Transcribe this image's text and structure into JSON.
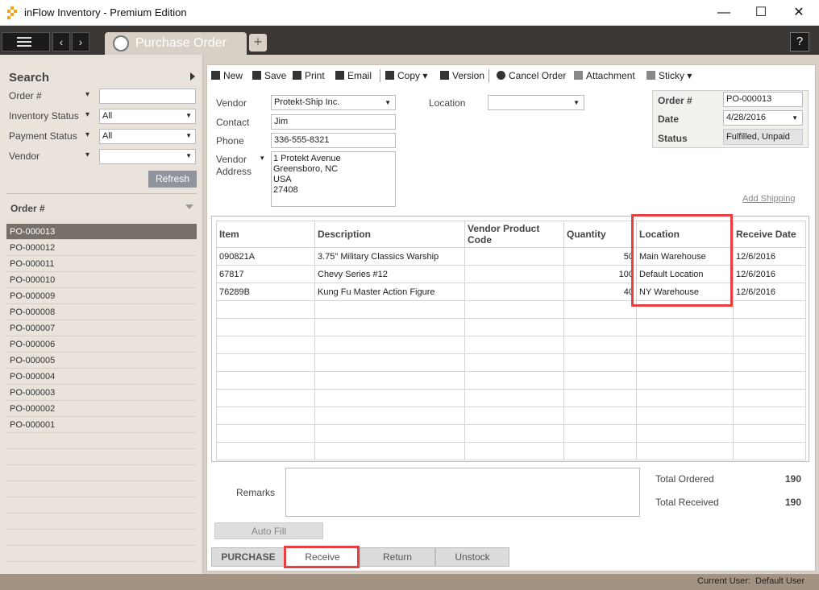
{
  "window": {
    "title": "inFlow Inventory - Premium Edition",
    "minimize": "—",
    "maximize": "☐",
    "close": "✕"
  },
  "topnav": {
    "menu_icon": "hamburger-icon",
    "back": "‹",
    "forward": "›",
    "tab_label": "Purchase Order",
    "add_tab": "+",
    "help": "?"
  },
  "sidebar": {
    "search_title": "Search",
    "filters": [
      {
        "label": "Order #",
        "value": ""
      },
      {
        "label": "Inventory Status",
        "value": "All"
      },
      {
        "label": "Payment Status",
        "value": "All"
      },
      {
        "label": "Vendor",
        "value": ""
      }
    ],
    "refresh": "Refresh",
    "order_header": "Order #",
    "orders": [
      "PO-000013",
      "PO-000012",
      "PO-000011",
      "PO-000010",
      "PO-000009",
      "PO-000008",
      "PO-000007",
      "PO-000006",
      "PO-000005",
      "PO-000004",
      "PO-000003",
      "PO-000002",
      "PO-000001"
    ]
  },
  "toolbar": {
    "new": "New",
    "save": "Save",
    "print": "Print",
    "email": "Email",
    "copy": "Copy",
    "version": "Version",
    "cancel": "Cancel Order",
    "attachment": "Attachment",
    "sticky": "Sticky"
  },
  "form": {
    "vendor_label": "Vendor",
    "vendor": "Protekt-Ship Inc.",
    "contact_label": "Contact",
    "contact": "Jim",
    "phone_label": "Phone",
    "phone": "336-555-8321",
    "address_label_1": "Vendor",
    "address_label_2": "Address",
    "address": [
      "1 Protekt Avenue",
      "Greensboro, NC",
      "USA",
      "27408"
    ],
    "location_label": "Location",
    "location": "",
    "order_label": "Order #",
    "order": "PO-000013",
    "date_label": "Date",
    "date": "4/28/2016",
    "status_label": "Status",
    "status": "Fulfilled, Unpaid",
    "add_shipping": "Add Shipping"
  },
  "grid": {
    "headers": [
      "Item",
      "Description",
      "Vendor Product Code",
      "Quantity",
      "Location",
      "Receive Date"
    ],
    "rows": [
      [
        "090821A",
        "3.75\" Military Classics Warship",
        "",
        "50",
        "Main Warehouse",
        "12/6/2016"
      ],
      [
        "67817",
        "Chevy Series #12",
        "",
        "100",
        "Default Location",
        "12/6/2016"
      ],
      [
        "76289B",
        "Kung Fu Master Action Figure",
        "",
        "40",
        "NY Warehouse",
        "12/6/2016"
      ]
    ]
  },
  "bottom": {
    "remarks_label": "Remarks",
    "total_ordered_label": "Total Ordered",
    "total_ordered": "190",
    "total_received_label": "Total Received",
    "total_received": "190",
    "auto_fill": "Auto Fill",
    "tabs": [
      "PURCHASE",
      "Receive",
      "Return",
      "Unstock"
    ]
  },
  "status": {
    "user_label": "Current User:",
    "user": "Default User"
  }
}
